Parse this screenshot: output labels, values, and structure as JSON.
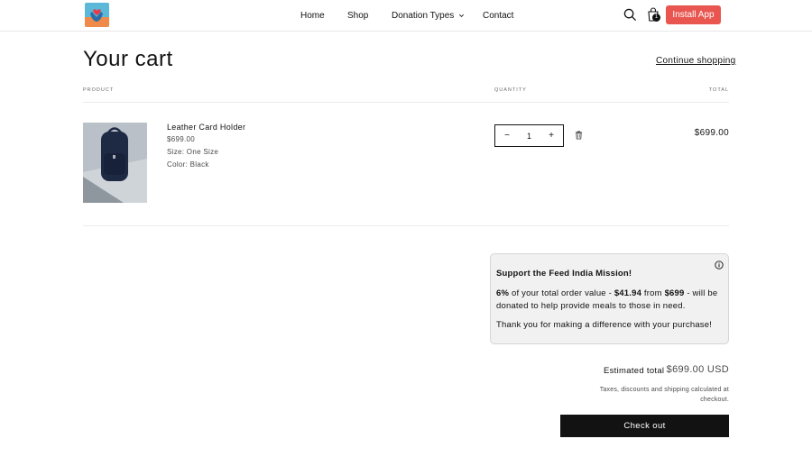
{
  "header": {
    "nav": {
      "home": "Home",
      "shop": "Shop",
      "donation_types": "Donation Types",
      "contact": "Contact"
    },
    "cart_count": "1",
    "install_label": "Install App",
    "accent_color": "#e8564f"
  },
  "cart": {
    "title": "Your cart",
    "continue_label": "Continue shopping",
    "columns": {
      "product": "PRODUCT",
      "quantity": "QUANTITY",
      "total": "TOTAL"
    },
    "items": [
      {
        "name": "Leather Card Holder",
        "price": "$699.00",
        "size": "Size: One Size",
        "color": "Color: Black",
        "quantity": "1",
        "minus": "−",
        "plus": "+",
        "line_total": "$699.00"
      }
    ]
  },
  "donation": {
    "title": "Support the Feed India Mission!",
    "percent": "6%",
    "text_1": " of your total order value - ",
    "amount": "$41.94",
    "text_2": " from ",
    "order_value": "$699",
    "text_3": " - will be donated to help provide meals to those in need.",
    "thanks": "Thank you for making a difference with your purchase!"
  },
  "summary": {
    "estimated_label": "Estimated total",
    "estimated_value": "$699.00 USD",
    "tax_note": "Taxes, discounts and shipping calculated at checkout.",
    "checkout_label": "Check out"
  }
}
